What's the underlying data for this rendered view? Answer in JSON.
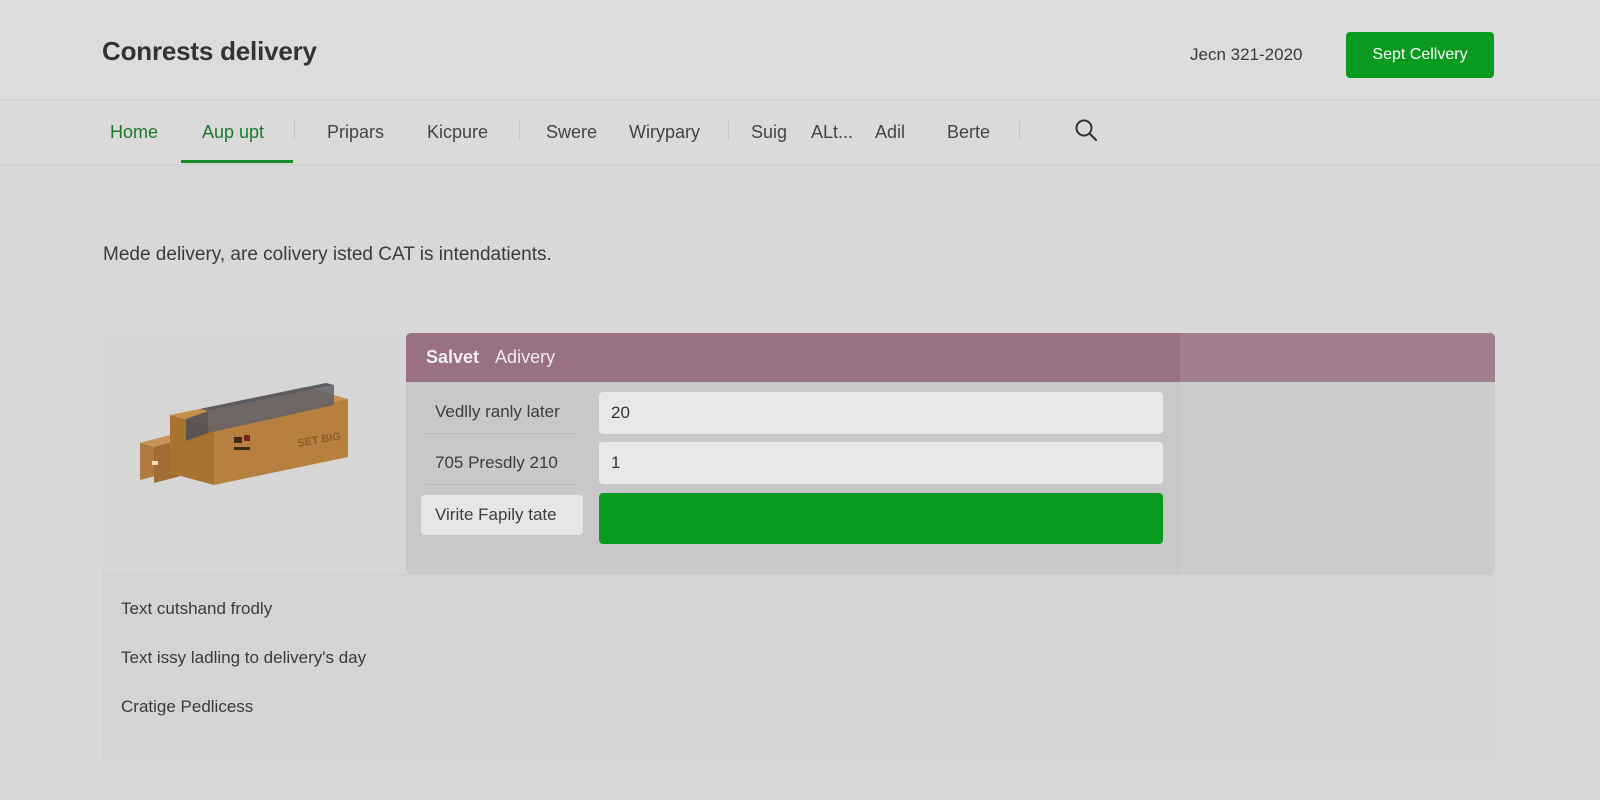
{
  "header": {
    "title": "Conrests delivery",
    "date": "Jecn 321-2020",
    "action_button": "Sept Cellvery"
  },
  "nav": {
    "items": [
      {
        "label": "Home"
      },
      {
        "label": "Aup upt"
      },
      {
        "label": "Pripars"
      },
      {
        "label": "Kicpure"
      },
      {
        "label": "Swere"
      },
      {
        "label": "Wirypary"
      },
      {
        "label": "Suig"
      },
      {
        "label": "ALt..."
      },
      {
        "label": "Adil"
      },
      {
        "label": "Berte"
      }
    ],
    "search_icon": "search-icon"
  },
  "intro": "Mede delivery, are colivery isted CAT is intendatients.",
  "product": {
    "image_icon": "package-box-icon",
    "box_label": "SET BIG"
  },
  "form": {
    "title": "Salvet",
    "subtitle": "Adivery",
    "fields": [
      {
        "label": "Vedlly ranly later",
        "value": "20"
      },
      {
        "label": "705 Presdly 210",
        "value": "1"
      },
      {
        "label": "Virite Fapily tate",
        "value": ""
      }
    ],
    "header_color": "#9a7084",
    "accent_color": "#0a9a1f"
  },
  "list": {
    "items": [
      "Text cutshand frodly",
      "Text issy ladling to delivery's day",
      "Cratige Pedlicess"
    ]
  }
}
